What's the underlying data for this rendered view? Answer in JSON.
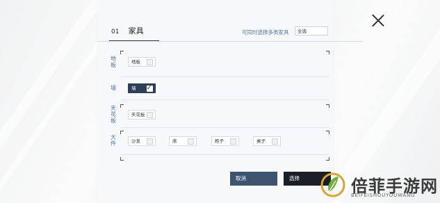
{
  "tab": {
    "number": "01",
    "title": "家具"
  },
  "multi_select_label": "可同时选择多类家具",
  "select_all": "全选",
  "categories": [
    {
      "label": "地板",
      "options": [
        {
          "label": "地板",
          "checked": false
        }
      ]
    },
    {
      "label": "墙",
      "options": [
        {
          "label": "墙",
          "checked": true
        }
      ]
    },
    {
      "label": "天花板",
      "options": [
        {
          "label": "天花板",
          "checked": false
        }
      ]
    },
    {
      "label": "大件",
      "options": [
        {
          "label": "沙发",
          "checked": false
        },
        {
          "label": "床",
          "checked": false
        },
        {
          "label": "柜子",
          "checked": false
        },
        {
          "label": "桌子",
          "checked": false
        }
      ]
    }
  ],
  "buttons": {
    "cancel": "取消",
    "select": "选择"
  },
  "watermark": {
    "title": "倍菲手游网",
    "subtitle": "BEIFEISHOUYOUWANG"
  },
  "colors": {
    "accent": "#2b3f56",
    "label_blue": "#4f77a8"
  }
}
